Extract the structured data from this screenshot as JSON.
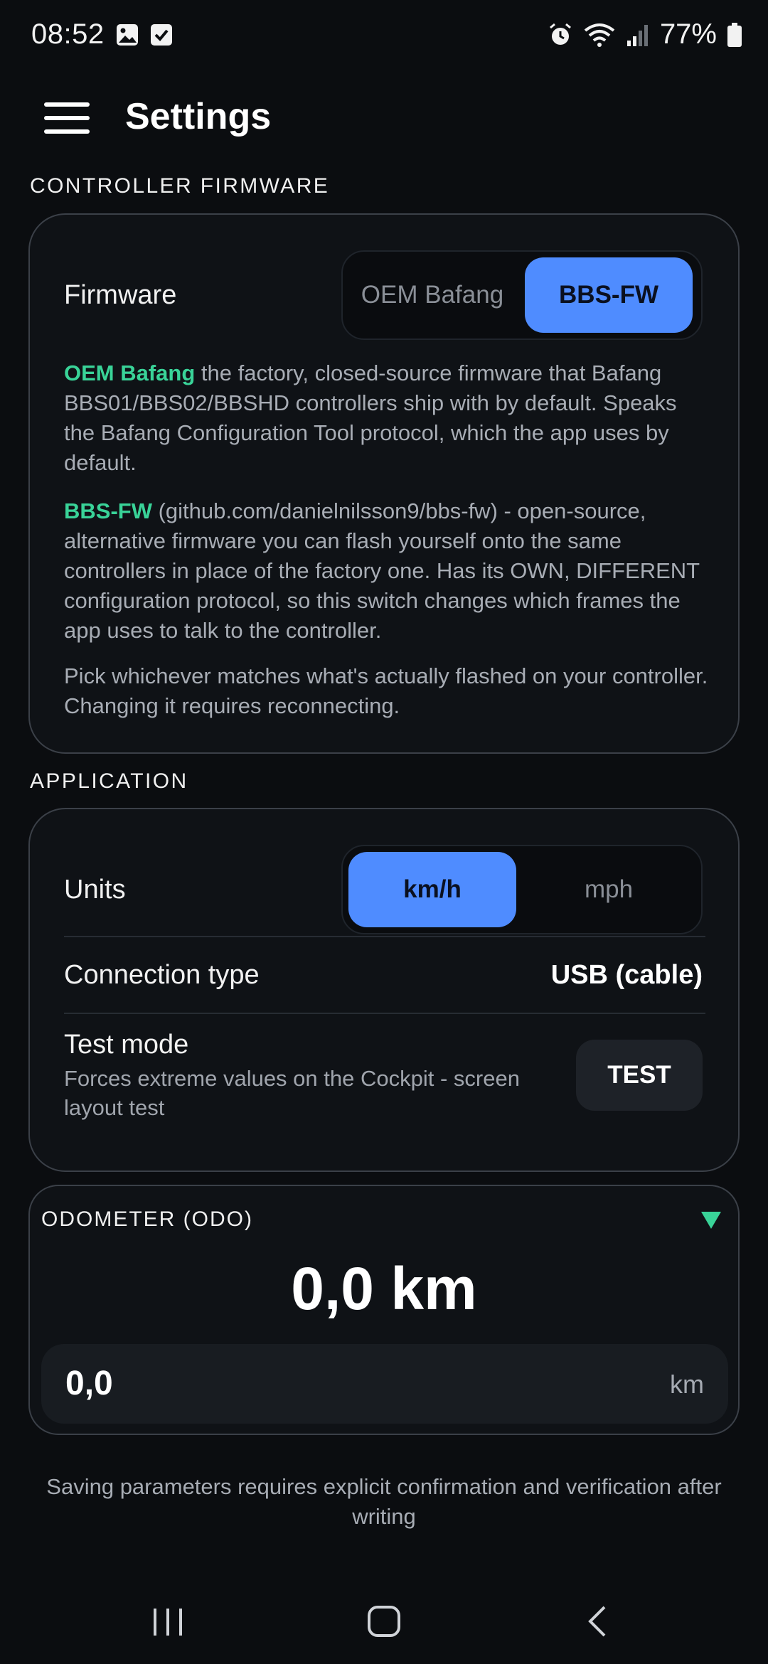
{
  "status_bar": {
    "time": "08:52",
    "battery_text": "77%",
    "icons": [
      "gallery-icon",
      "check-icon",
      "alarm-icon",
      "wifi-icon",
      "signal-icon",
      "battery-icon"
    ]
  },
  "app_bar": {
    "title": "Settings",
    "menu_icon": "hamburger-menu-icon"
  },
  "controller_firmware": {
    "section_label": "CONTROLLER FIRMWARE",
    "firmware_label": "Firmware",
    "options": [
      "OEM Bafang",
      "BBS-FW"
    ],
    "selected": "BBS-FW",
    "desc1_hl": "OEM Bafang",
    "desc1_rest": " the factory, closed-source firmware that Bafang BBS01/BBS02/BBSHD controllers ship with by default. Speaks the Bafang Configuration Tool protocol, which the app uses by default.",
    "desc2_hl": "BBS-FW",
    "desc2_rest": " (github.com/danielnilsson9/bbs-fw) - open-source, alternative firmware you can flash yourself onto the same controllers in place of the factory one. Has its OWN, DIFFERENT configuration protocol, so this switch changes which frames the app uses to talk to the controller.",
    "desc3": "Pick whichever matches what's actually flashed on your controller. Changing it requires reconnecting."
  },
  "application": {
    "section_label": "APPLICATION",
    "units_label": "Units",
    "units_options": [
      "km/h",
      "mph"
    ],
    "units_selected": "km/h",
    "connection_label": "Connection type",
    "connection_value": "USB (cable)",
    "test_label": "Test mode",
    "test_sub": "Forces extreme values on the Cockpit - screen layout test",
    "test_button": "TEST"
  },
  "odometer": {
    "title": "ODOMETER (ODO)",
    "value_display": "0,0 km",
    "input_value": "0,0",
    "input_unit": "km"
  },
  "footer_note": "Saving parameters requires explicit confirmation and verification after writing",
  "colors": {
    "background": "#0b0d10",
    "accent_blue": "#4f8cff",
    "accent_green": "#39d398",
    "card_border": "#3b4048"
  }
}
